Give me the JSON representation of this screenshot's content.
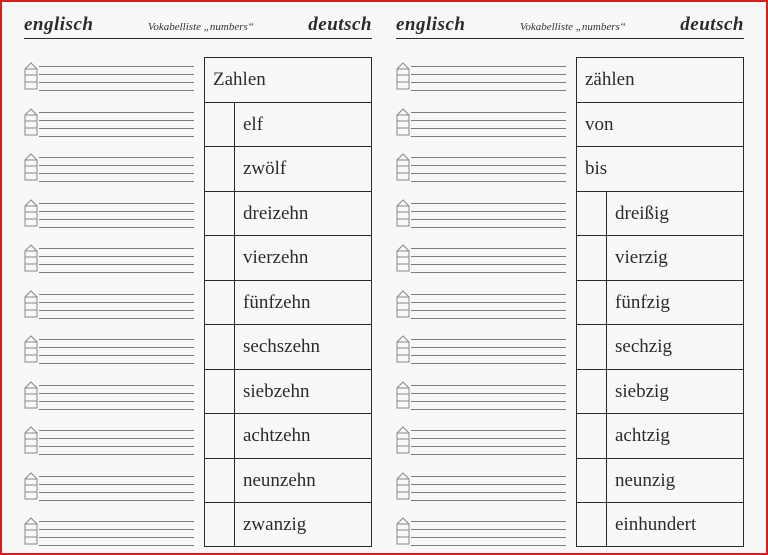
{
  "left": {
    "header": {
      "lang_left": "englisch",
      "subtitle": "Vokabelliste „numbers“",
      "lang_right": "deutsch"
    },
    "rows": [
      {
        "indent": false,
        "de": "Zahlen"
      },
      {
        "indent": true,
        "de": "elf"
      },
      {
        "indent": true,
        "de": "zwölf"
      },
      {
        "indent": true,
        "de": "dreizehn"
      },
      {
        "indent": true,
        "de": "vierzehn"
      },
      {
        "indent": true,
        "de": "fünfzehn"
      },
      {
        "indent": true,
        "de": "sechszehn"
      },
      {
        "indent": true,
        "de": "siebzehn"
      },
      {
        "indent": true,
        "de": "achtzehn"
      },
      {
        "indent": true,
        "de": "neunzehn"
      },
      {
        "indent": true,
        "de": "zwanzig"
      }
    ]
  },
  "right": {
    "header": {
      "lang_left": "englisch",
      "subtitle": "Vokabelliste „numbers“",
      "lang_right": "deutsch"
    },
    "rows": [
      {
        "indent": false,
        "de": "zählen"
      },
      {
        "indent": false,
        "de": "von"
      },
      {
        "indent": false,
        "de": "bis"
      },
      {
        "indent": true,
        "de": "dreißig"
      },
      {
        "indent": true,
        "de": "vierzig"
      },
      {
        "indent": true,
        "de": "fünfzig"
      },
      {
        "indent": true,
        "de": "sechzig"
      },
      {
        "indent": true,
        "de": "siebzig"
      },
      {
        "indent": true,
        "de": "achtzig"
      },
      {
        "indent": true,
        "de": "neunzig"
      },
      {
        "indent": true,
        "de": "einhundert"
      }
    ]
  }
}
